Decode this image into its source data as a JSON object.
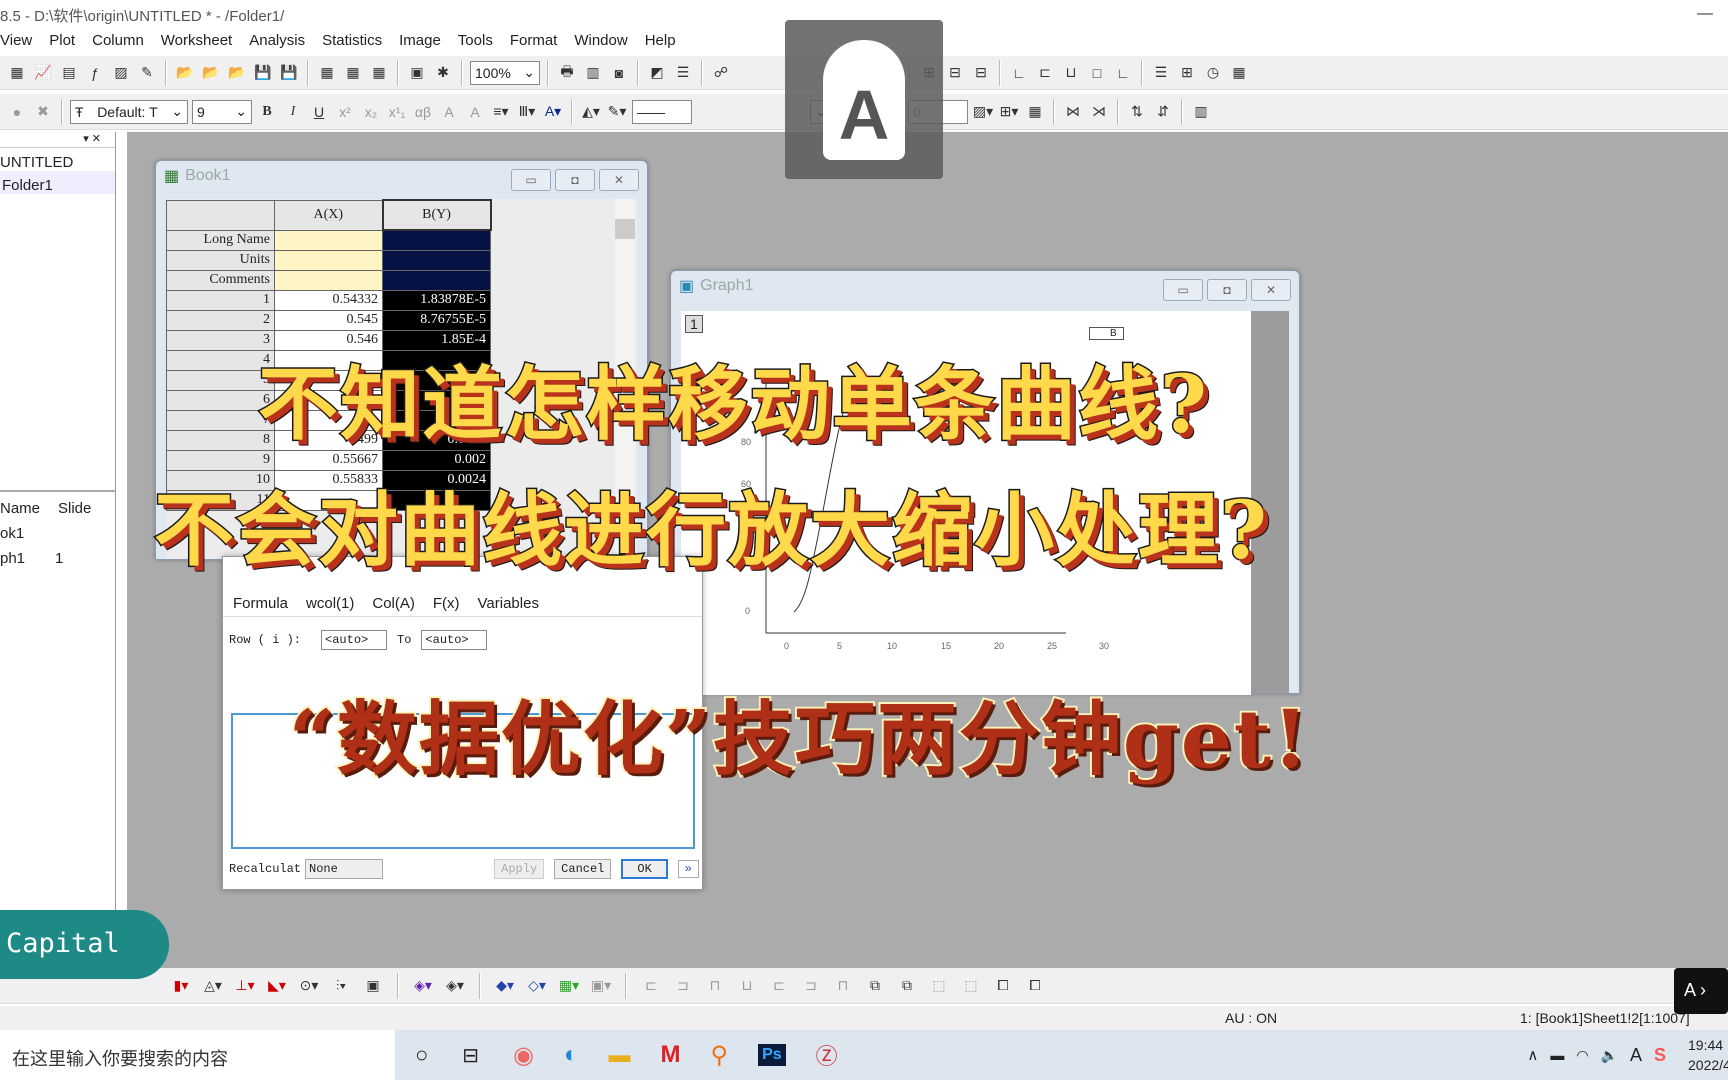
{
  "window": {
    "title": "8.5 - D:\\软件\\origin\\UNTITLED * - /Folder1/"
  },
  "menu": [
    "View",
    "Plot",
    "Column",
    "Worksheet",
    "Analysis",
    "Statistics",
    "Image",
    "Tools",
    "Format",
    "Window",
    "Help"
  ],
  "toolbar": {
    "zoom": "100%",
    "font": "Default: T",
    "font_size": "9",
    "line_width_label": "N",
    "line_value": "0"
  },
  "project": {
    "root": "UNTITLED",
    "folder": "Folder1",
    "columns": [
      "Name",
      "Slide"
    ],
    "items": [
      {
        "name": "ok1",
        "slide": ""
      },
      {
        "name": "ph1",
        "slide": "1"
      }
    ]
  },
  "book": {
    "title": "Book1",
    "col_a": "A(X)",
    "col_b": "B(Y)",
    "label_rows": [
      "Long Name",
      "Units",
      "Comments"
    ],
    "rows": [
      {
        "n": "1",
        "a": "0.54332",
        "b": "1.83878E-5"
      },
      {
        "n": "2",
        "a": "0.545",
        "b": "8.76755E-5"
      },
      {
        "n": "3",
        "a": "0.546",
        "b": "1.85E-4"
      },
      {
        "n": "4",
        "a": "",
        "b": ""
      },
      {
        "n": "5",
        "a": "",
        "b": ""
      },
      {
        "n": "6",
        "a": "",
        "b": ""
      },
      {
        "n": "7",
        "a": "",
        "b": ""
      },
      {
        "n": "8",
        "a": "499",
        "b": "0.0015"
      },
      {
        "n": "9",
        "a": "0.55667",
        "b": "0.002"
      },
      {
        "n": "10",
        "a": "0.55833",
        "b": "0.0024"
      },
      {
        "n": "11",
        "a": "",
        "b": ""
      }
    ]
  },
  "graph": {
    "title": "Graph1",
    "layer": "1",
    "legend": "B",
    "yticks": [
      "0",
      "60",
      "80"
    ],
    "xticks": [
      "0",
      "5",
      "10",
      "15",
      "20",
      "25",
      "30"
    ]
  },
  "dialog": {
    "tabs": [
      "Formula",
      "wcol(1)",
      "Col(A)",
      "F(x)",
      "Variables"
    ],
    "row_label": "Row ( i ):",
    "row_from": "<auto>",
    "to_label": "To",
    "row_to": "<auto>",
    "recalc_label": "Recalculat",
    "recalc_value": "None",
    "apply": "Apply",
    "cancel": "Cancel",
    "ok": "OK"
  },
  "overlay": {
    "line1": "不知道怎样移动单条曲线?",
    "line2": "不会对曲线进行放大缩小处理?",
    "line3": "“数据优化”技巧两分钟get!",
    "badge": "Capital"
  },
  "status": {
    "au": "AU : ON",
    "sheet": "1: [Book1]Sheet1!2[1:1007]"
  },
  "taskbar": {
    "search_placeholder": "在这里输入你要搜索的内容",
    "time": "19:44",
    "date": "2022/4"
  },
  "colors": {
    "overlay_yellow": "#ffd94a",
    "overlay_red": "#b02f17",
    "badge": "#1e8a86",
    "worksheet_selected": "#061244"
  }
}
